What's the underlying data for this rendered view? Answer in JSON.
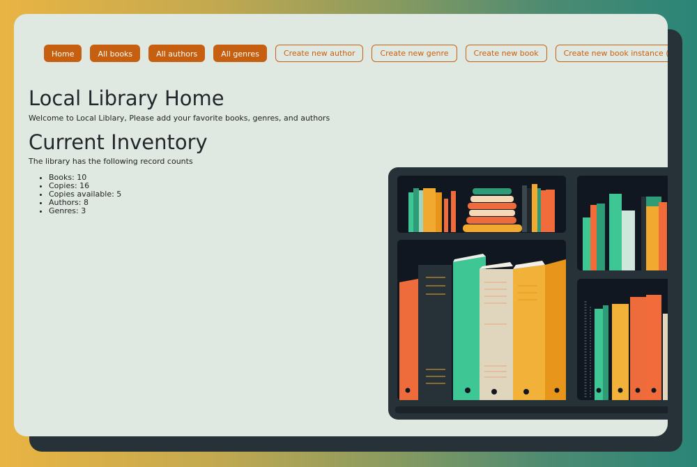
{
  "nav": {
    "items": [
      {
        "label": "Home",
        "style": "solid"
      },
      {
        "label": "All books",
        "style": "solid"
      },
      {
        "label": "All authors",
        "style": "solid"
      },
      {
        "label": "All genres",
        "style": "solid"
      },
      {
        "label": "Create new author",
        "style": "outline"
      },
      {
        "label": "Create new genre",
        "style": "outline"
      },
      {
        "label": "Create new book",
        "style": "outline"
      },
      {
        "label": "Create new book instance (copy)",
        "style": "outline"
      }
    ]
  },
  "main": {
    "title": "Local Library Home",
    "welcome": "Welcome to Local Liblary, Please add your favorite books, genres, and authors",
    "inventory_title": "Current Inventory",
    "inventory_intro": "The library has the following record counts",
    "counts": [
      "Books: 10",
      "Copies: 16",
      "Copies available: 5",
      "Authors: 8",
      "Genres: 3"
    ]
  },
  "theme": {
    "accent": "#c75f10",
    "card_bg": "#e0e8e2",
    "shelf_dark": "#263238"
  },
  "illustration": {
    "icon": "bookshelf-illustration"
  }
}
